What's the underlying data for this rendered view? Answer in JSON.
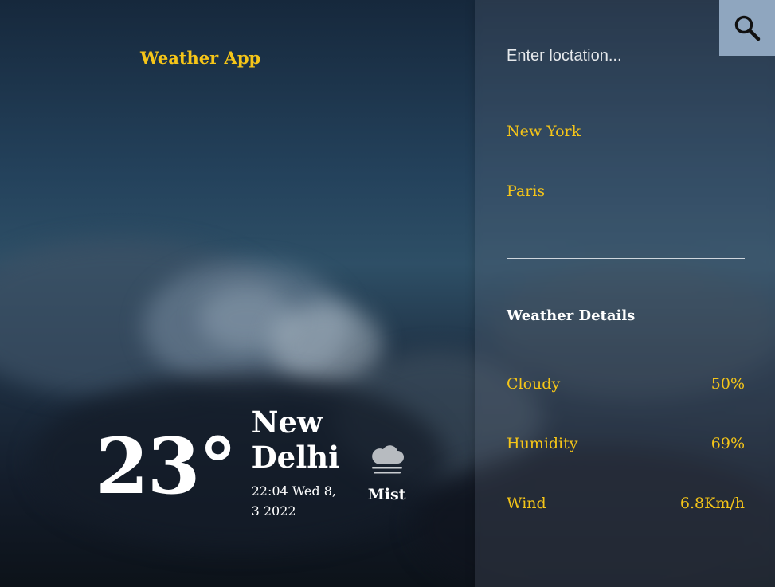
{
  "app": {
    "title": "Weather App"
  },
  "current": {
    "temperature": "23°",
    "city": "New Delhi",
    "datetime": "22:04 Wed 8, 3 2022",
    "condition": "Mist",
    "condition_icon": "cloud-icon"
  },
  "search": {
    "placeholder": "Enter loctation...",
    "value": "",
    "icon": "search-icon"
  },
  "locations": [
    "New York",
    "Paris"
  ],
  "details": {
    "title": "Weather Details",
    "rows": [
      {
        "label": "Cloudy",
        "value": "50%"
      },
      {
        "label": "Humidity",
        "value": "69%"
      },
      {
        "label": "Wind",
        "value": "6.8Km/h"
      }
    ]
  },
  "colors": {
    "accent": "#f5c518",
    "search_button": "#8fa6bf",
    "text": "#ffffff"
  }
}
